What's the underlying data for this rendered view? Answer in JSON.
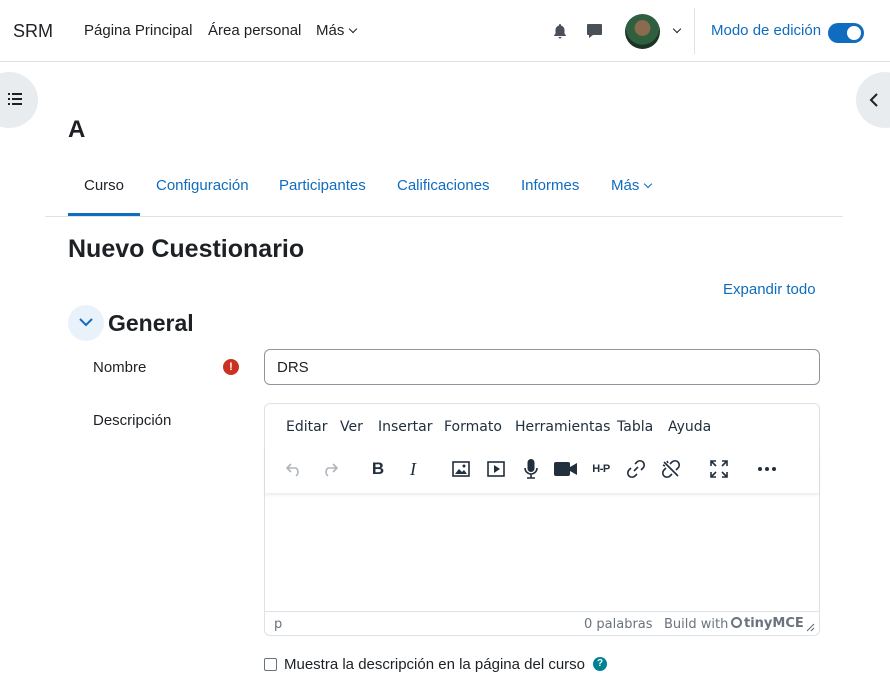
{
  "header": {
    "brand": "SRM",
    "nav": [
      "Página Principal",
      "Área personal",
      "Más"
    ],
    "edit_mode_label": "Modo de edición",
    "edit_mode_on": true
  },
  "course": {
    "title": "A",
    "tabs": [
      "Curso",
      "Configuración",
      "Participantes",
      "Calificaciones",
      "Informes",
      "Más"
    ],
    "active_tab": "Curso"
  },
  "page": {
    "heading": "Nuevo Cuestionario",
    "expand_all": "Expandir todo"
  },
  "section": {
    "title": "General",
    "name_label": "Nombre",
    "name_value": "DRS",
    "required_icon": "!",
    "description_label": "Descripción"
  },
  "editor": {
    "menu": [
      "Editar",
      "Ver",
      "Insertar",
      "Formato",
      "Herramientas",
      "Tabla",
      "Ayuda"
    ],
    "toolbar_icons": [
      "undo-icon",
      "redo-icon",
      "bold-icon",
      "italic-icon",
      "image-icon",
      "media-icon",
      "microphone-icon",
      "video-icon",
      "h5p-icon",
      "link-icon",
      "unlink-icon",
      "fullscreen-icon",
      "more-icon"
    ],
    "bold_glyph": "B",
    "italic_glyph": "I",
    "h5p_text": "H-P",
    "status_path": "p",
    "word_count": "0 palabras",
    "build_with": "Build with",
    "brand": "tinyMCE"
  },
  "show_description": {
    "label": "Muestra la descripción en la página del curso",
    "checked": false,
    "help_icon": "?"
  },
  "colors": {
    "primary": "#0f6cbf",
    "danger": "#ca3120",
    "info": "#008196"
  }
}
